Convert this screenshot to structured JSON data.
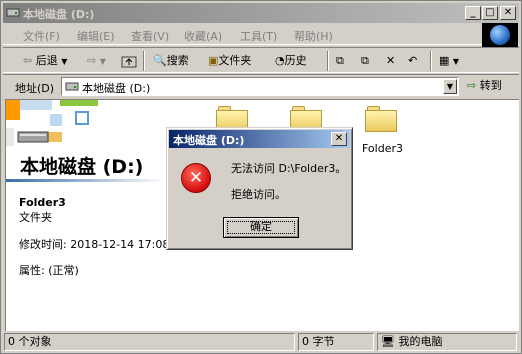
{
  "window": {
    "title": "本地磁盘 (D:)",
    "caption_minimize": "_",
    "caption_maximize": "□",
    "caption_close": "✕"
  },
  "menu": [
    "文件(F)",
    "编辑(E)",
    "查看(V)",
    "收藏(A)",
    "工具(T)",
    "帮助(H)"
  ],
  "toolbar": {
    "back": "后退",
    "search": "搜索",
    "folders": "文件夹",
    "history": "历史"
  },
  "address": {
    "label": "地址(D)",
    "value": "本地磁盘 (D:)",
    "go": "转到"
  },
  "content": {
    "drive_title": "本地磁盘 (D:)",
    "selected_name": "Folder3",
    "selected_type": "文件夹",
    "modified": "修改时间: 2018-12-14 17:08",
    "attributes": "属性: (正常)",
    "folders": [
      "",
      "",
      "Folder3"
    ]
  },
  "dialog": {
    "title": "本地磁盘 (D:)",
    "close": "✕",
    "message1": "无法访问 D:\\Folder3。",
    "message2": "拒绝访问。",
    "ok": "确定"
  },
  "status": {
    "objects": "0 个对象",
    "size": "0 字节",
    "location": "我的电脑"
  },
  "colors": {
    "inactive_title_start": "#7f7f7f",
    "active_title_start": "#0a246a",
    "active_title_end": "#a6caf0",
    "error_red": "#d40d0d"
  }
}
